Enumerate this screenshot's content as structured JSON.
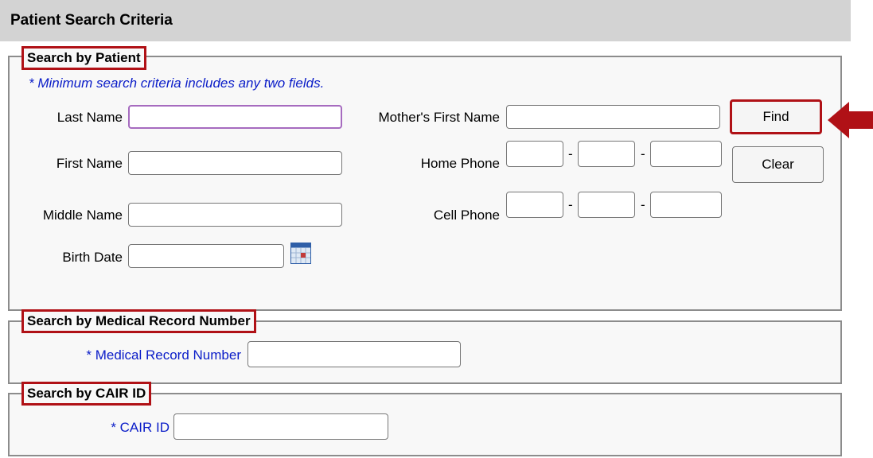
{
  "header": {
    "title": "Patient Search Criteria"
  },
  "patient_section": {
    "legend": "Search by Patient",
    "note": "* Minimum search criteria includes any two fields.",
    "last_name_label": "Last Name",
    "first_name_label": "First Name",
    "middle_name_label": "Middle Name",
    "birth_date_label": "Birth Date",
    "mothers_first_name_label": "Mother's First Name",
    "home_phone_label": "Home Phone",
    "cell_phone_label": "Cell Phone",
    "phone_separator": "-",
    "find_label": "Find",
    "clear_label": "Clear",
    "values": {
      "last_name": "",
      "first_name": "",
      "middle_name": "",
      "birth_date": "",
      "mothers_first_name": "",
      "home_phone_area": "",
      "home_phone_prefix": "",
      "home_phone_line": "",
      "cell_phone_area": "",
      "cell_phone_prefix": "",
      "cell_phone_line": ""
    }
  },
  "mrn_section": {
    "legend": "Search by Medical Record Number",
    "mrn_label": "* Medical Record Number",
    "values": {
      "mrn": ""
    }
  },
  "cair_section": {
    "legend": "Search by CAIR ID",
    "cair_label": "* CAIR ID",
    "values": {
      "cair_id": ""
    }
  },
  "icons": {
    "calendar": "calendar-icon",
    "arrow": "arrow-left-icon"
  },
  "colors": {
    "highlight": "#b01116",
    "required_text": "#0a1cc8",
    "header_bg": "#d3d3d3",
    "focus_border": "#a66bbf"
  }
}
